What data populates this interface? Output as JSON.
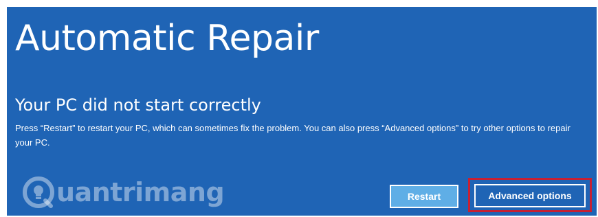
{
  "screen": {
    "title": "Automatic Repair",
    "subtitle": "Your PC did not start correctly",
    "message": "Press “Restart” to restart your PC, which can sometimes fix the problem. You can also press “Advanced options” to try other options to repair your PC."
  },
  "buttons": {
    "restart_label": "Restart",
    "advanced_label": "Advanced options"
  },
  "watermark": {
    "text": "uantrimang"
  },
  "colors": {
    "background": "#1f64b5",
    "restart_button": "#5faee6",
    "highlight_border": "#c62033",
    "text": "#ffffff"
  }
}
